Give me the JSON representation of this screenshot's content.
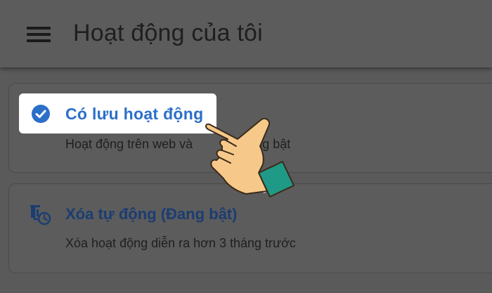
{
  "app_bar": {
    "title": "Hoạt động của tôi",
    "menu_icon": "hamburger-menu-icon"
  },
  "cards": [
    {
      "icon": "check-circle-icon",
      "title": "Có lưu hoạt động",
      "subtitle_left": "Hoạt động trên web và",
      "subtitle_right": "ng đang bật",
      "highlighted": true
    },
    {
      "icon": "auto-delete-icon",
      "title": "Xóa tự động (Đang bật)",
      "subtitle": "Xóa hoạt động diễn ra hơn 3 tháng trước"
    }
  ],
  "colors": {
    "overlay_background": "#5a5a5a",
    "link_blue": "#2b6fc9",
    "dim_blue": "#1b3d72",
    "highlight": "#ffffff",
    "hand_skin": "#f6c98a",
    "cuff": "#1f9a86"
  },
  "overlay_icon": "pointing-hand-icon"
}
